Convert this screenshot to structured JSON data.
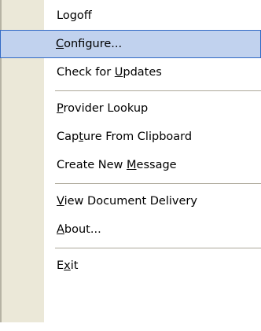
{
  "menu": {
    "items": [
      {
        "id": "logoff",
        "label": "Logoff",
        "underline": 5
      },
      {
        "id": "configure",
        "label": "Configure...",
        "underline": 0,
        "highlighted": true
      },
      {
        "id": "check-updates",
        "label": "Check for Updates",
        "underline": 10
      },
      {
        "id": "provider-lookup",
        "label": "Provider Lookup",
        "underline": 0
      },
      {
        "id": "capture-clipboard",
        "label": "Capture From Clipboard",
        "underline": 3
      },
      {
        "id": "create-message",
        "label": "Create New Message",
        "underline": 11
      },
      {
        "id": "view-document-delivery",
        "label": "View Document Delivery",
        "underline": 0
      },
      {
        "id": "about",
        "label": "About...",
        "underline": 0
      },
      {
        "id": "exit",
        "label": "Exit",
        "underline": 1
      }
    ]
  },
  "colors": {
    "gutter": "#ebe8d8",
    "highlight_fill": "#c1d2ee",
    "highlight_border": "#316ac5",
    "separator": "#aca899"
  }
}
